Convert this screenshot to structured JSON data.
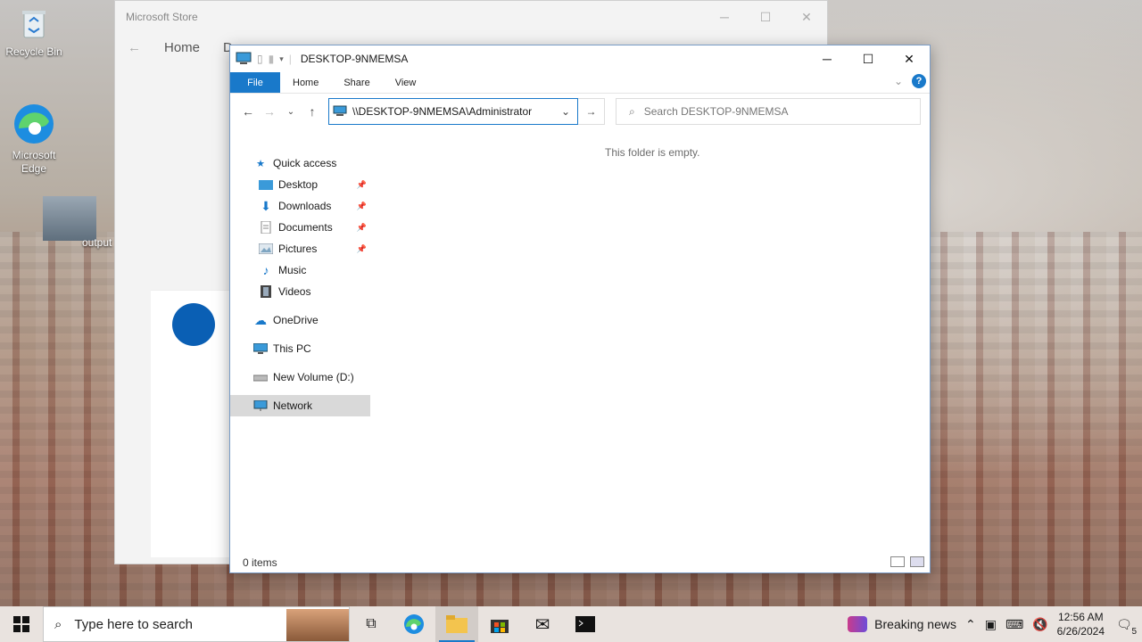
{
  "desktop": {
    "icons": [
      {
        "label": "Recycle Bin"
      },
      {
        "label": "Microsoft Edge"
      },
      {
        "label": "output"
      }
    ]
  },
  "store": {
    "title": "Microsoft Store",
    "nav_home": "Home",
    "nav_partial": "D"
  },
  "explorer": {
    "title": "DESKTOP-9NMEMSA",
    "tabs": [
      "File",
      "Home",
      "Share",
      "View"
    ],
    "address": "\\\\DESKTOP-9NMEMSA\\Administrator",
    "search_placeholder": "Search DESKTOP-9NMEMSA",
    "nav": {
      "quick_access": "Quick access",
      "desktop": "Desktop",
      "downloads": "Downloads",
      "documents": "Documents",
      "pictures": "Pictures",
      "music": "Music",
      "videos": "Videos",
      "onedrive": "OneDrive",
      "this_pc": "This PC",
      "new_volume": "New Volume (D:)",
      "network": "Network"
    },
    "empty_message": "This folder is empty.",
    "status": "0 items"
  },
  "taskbar": {
    "search_placeholder": "Type here to search",
    "news": "Breaking news",
    "time": "12:56 AM",
    "date": "6/26/2024",
    "notifications": "5"
  },
  "colors": {
    "accent": "#1979ca"
  }
}
